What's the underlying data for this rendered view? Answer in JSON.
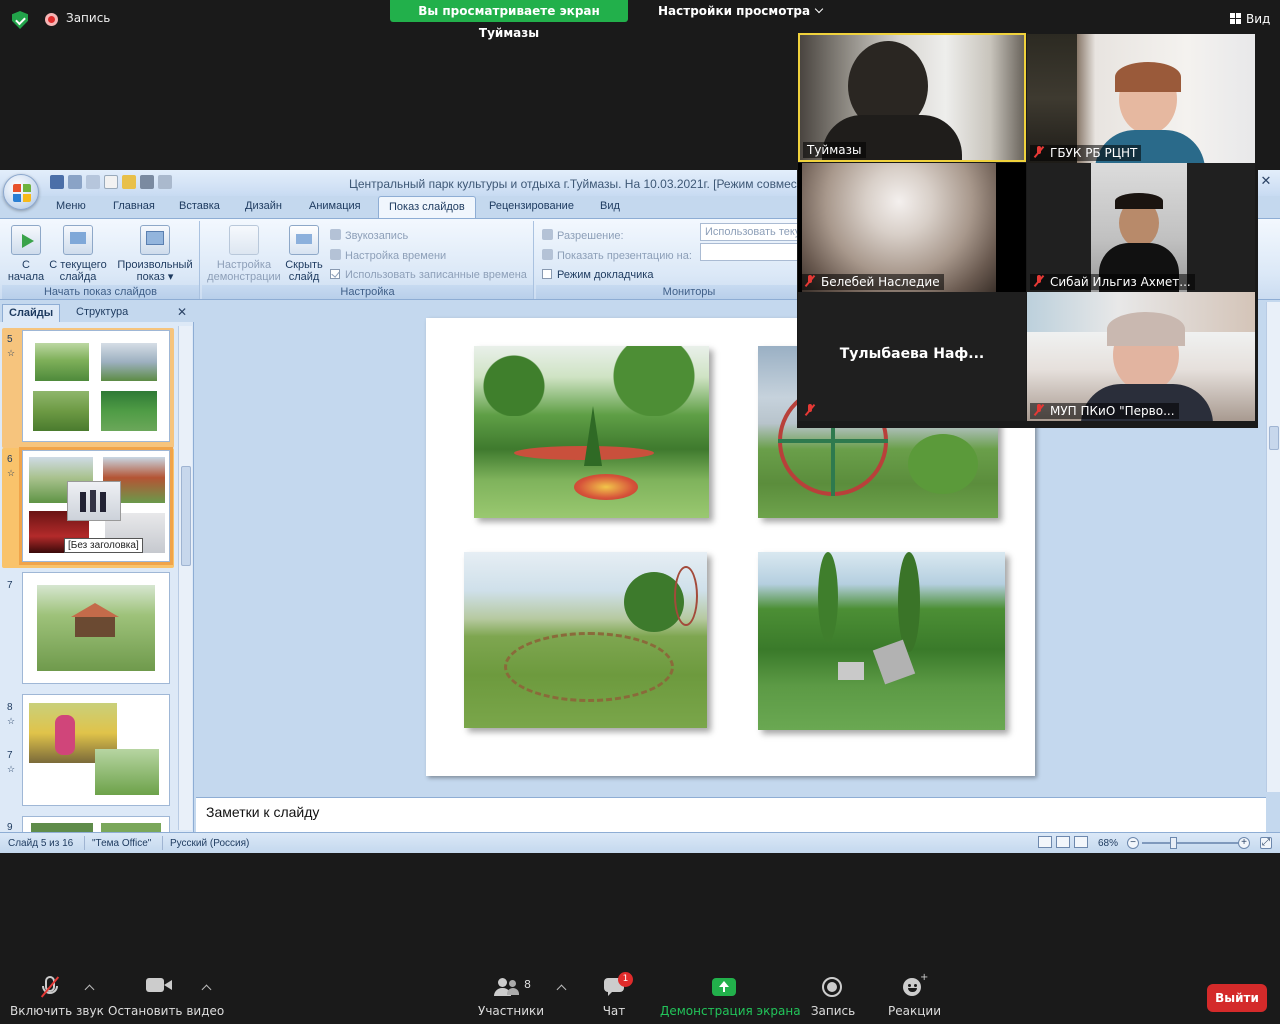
{
  "zoom_top": {
    "record_label": "Запись",
    "viewing_banner": "Вы просматриваете экран Туймазы",
    "view_settings": "Настройки просмотра",
    "view_button": "Вид",
    "colors": {
      "banner": "#22b04b",
      "record": "#e02b2b"
    }
  },
  "ppt": {
    "window_title": "Центральный парк культуры и отдыха г.Туймазы. На 10.03.2021г. [Режим совместимо",
    "tabs": [
      "Меню",
      "Главная",
      "Вставка",
      "Дизайн",
      "Анимация",
      "Показ слайдов",
      "Рецензирование",
      "Вид"
    ],
    "active_tab": "Показ слайдов",
    "ribbon": {
      "group_start": {
        "label": "Начать показ слайдов",
        "btn_from_start": [
          "С",
          "начала"
        ],
        "btn_from_current": [
          "С текущего",
          "слайда"
        ],
        "btn_custom": [
          "Произвольный",
          "показ ▾"
        ]
      },
      "group_setup": {
        "label": "Настройка",
        "btn_setup": [
          "Настройка",
          "демонстрации"
        ],
        "btn_hide": [
          "Скрыть",
          "слайд"
        ],
        "sound": "Звукозапись",
        "timing": "Настройка времени",
        "use_timings": "Использовать записанные времена"
      },
      "group_monitors": {
        "label": "Мониторы",
        "resolution": "Разрешение:",
        "show_on": "Показать презентацию на:",
        "presenter_mode": "Режим докладчика",
        "resolution_value": "Использовать текущ"
      }
    },
    "pane": {
      "tab_slides": "Слайды",
      "tab_outline": "Структура",
      "thumbs": [
        {
          "num": "5"
        },
        {
          "num": "6"
        },
        {
          "num": "7"
        },
        {
          "num": "8"
        },
        {
          "num": "9"
        }
      ],
      "tooltip": "[Без заголовка]"
    },
    "notes_placeholder": "Заметки к слайду",
    "status": {
      "slide": "Слайд 5 из 16",
      "theme": "\"Тема Office\"",
      "language": "Русский (Россия)",
      "zoom": "68%"
    }
  },
  "gallery": {
    "tiles": [
      {
        "name": "Туймазы",
        "muted": false,
        "active": true
      },
      {
        "name": "ГБУК РБ РЦНТ",
        "muted": true,
        "active": false
      },
      {
        "name": "Белебей Наследие",
        "muted": true,
        "active": false
      },
      {
        "name": "Сибай Ильгиз Ахмет...",
        "muted": true,
        "active": false
      },
      {
        "name": "Тулыбаева  Наф...",
        "muted": true,
        "active": false,
        "video_off": true
      },
      {
        "name": "МУП ПКиО \"Перво...",
        "muted": true,
        "active": false
      }
    ]
  },
  "zoom_bottom": {
    "unmute": "Включить звук",
    "stop_video": "Остановить видео",
    "participants": "Участники",
    "participants_count": "8",
    "chat": "Чат",
    "chat_badge": "1",
    "share": "Демонстрация экрана",
    "record": "Запись",
    "reactions": "Реакции",
    "leave": "Выйти",
    "colors": {
      "share": "#22b04b",
      "leave": "#d42a2a"
    }
  }
}
